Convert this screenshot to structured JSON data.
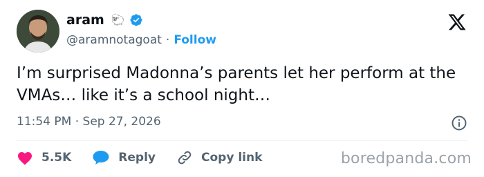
{
  "author": {
    "display_name": "aram",
    "name_emoji": "🐑",
    "handle": "@aramnotagoat",
    "separator": "·",
    "follow_label": "Follow",
    "verified_badge_color": "#1d9bf0"
  },
  "tweet": {
    "text": "I’m surprised Madonna’s parents let her perform at the VMAs… like it’s a school night…",
    "timestamp": "11:54 PM · Sep 27, 2026"
  },
  "actions": {
    "likes_count": "5.5K",
    "like_icon_color": "#f91880",
    "reply_label": "Reply",
    "reply_icon_color": "#1d9bf0",
    "copy_link_label": "Copy link"
  },
  "watermark": "boredpanda.com",
  "icons": {
    "brand": "x-logo-icon",
    "info": "info-icon",
    "like": "heart-icon",
    "reply": "speech-bubble-icon",
    "copy_link": "link-icon"
  }
}
